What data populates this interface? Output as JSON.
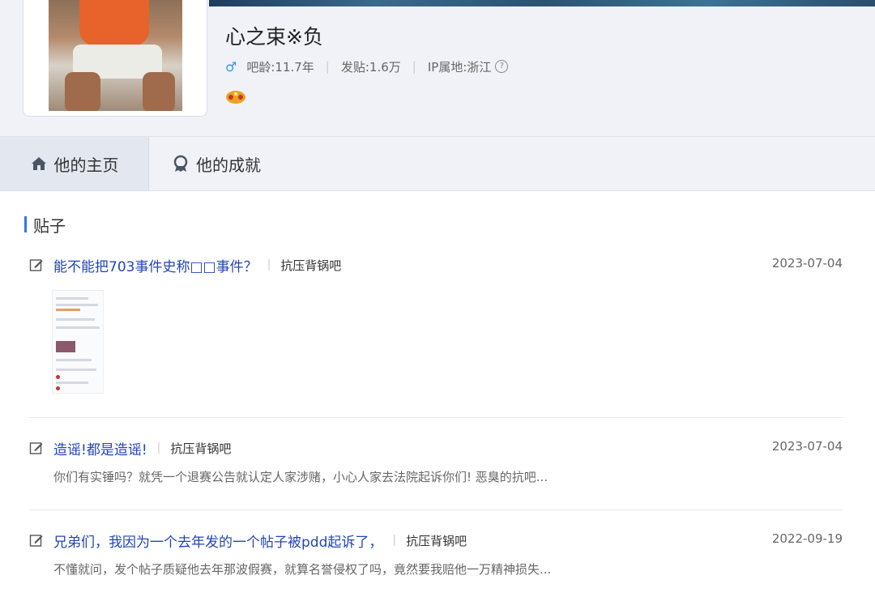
{
  "profile": {
    "username": "心之束※负",
    "bar_age": "吧龄:11.7年",
    "posts_count": "发贴:1.6万",
    "ip_location": "IP属地:浙江",
    "help_glyph": "?",
    "gender_icon": "male-icon",
    "badge_icon": "gamepad-badge-icon"
  },
  "tabs": [
    {
      "label": "他的主页",
      "icon": "home-icon",
      "active": true
    },
    {
      "label": "他的成就",
      "icon": "medal-icon",
      "active": false
    }
  ],
  "section": {
    "title": "贴子"
  },
  "posts": [
    {
      "title": "能不能把703事件史称□□事件？",
      "forum": "抗压背锅吧",
      "date": "2023-07-04",
      "excerpt": "",
      "has_thumbnail": true
    },
    {
      "title": "造谣!都是造谣!",
      "forum": "抗压背锅吧",
      "date": "2023-07-04",
      "excerpt": "你们有实锤吗？就凭一个退赛公告就认定人家涉赌，小心人家去法院起诉你们! 恶臭的抗吧...",
      "has_thumbnail": false
    },
    {
      "title": "兄弟们，我因为一个去年发的一个帖子被pdd起诉了，",
      "forum": "抗压背锅吧",
      "date": "2022-09-19",
      "excerpt": "不懂就问，发个帖子质疑他去年那波假赛，就算名誉侵权了吗，竟然要我赔他一万精神损失...",
      "has_thumbnail": false
    }
  ],
  "colors": {
    "link": "#2345b8",
    "accent": "#3474e0",
    "header_bg": "#f0f2f7"
  }
}
